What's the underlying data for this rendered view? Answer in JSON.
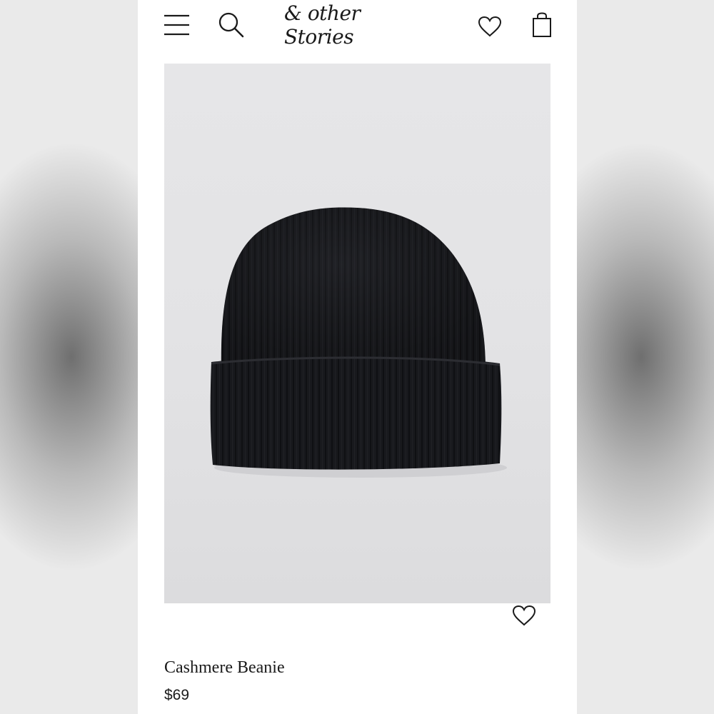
{
  "header": {
    "logo_text": "& other Stories",
    "icons": {
      "menu": "hamburger-menu-icon",
      "search": "search-icon",
      "wishlist": "heart-icon",
      "bag": "shopping-bag-icon"
    }
  },
  "product": {
    "name": "Cashmere Beanie",
    "price": "$69",
    "image_subject": "black ribbed knit beanie",
    "colors": {
      "beanie": "#1b1c20",
      "background": "#e4e4e6"
    }
  },
  "colors": {
    "text": "#1a1a1a",
    "page_background": "#ffffff"
  }
}
